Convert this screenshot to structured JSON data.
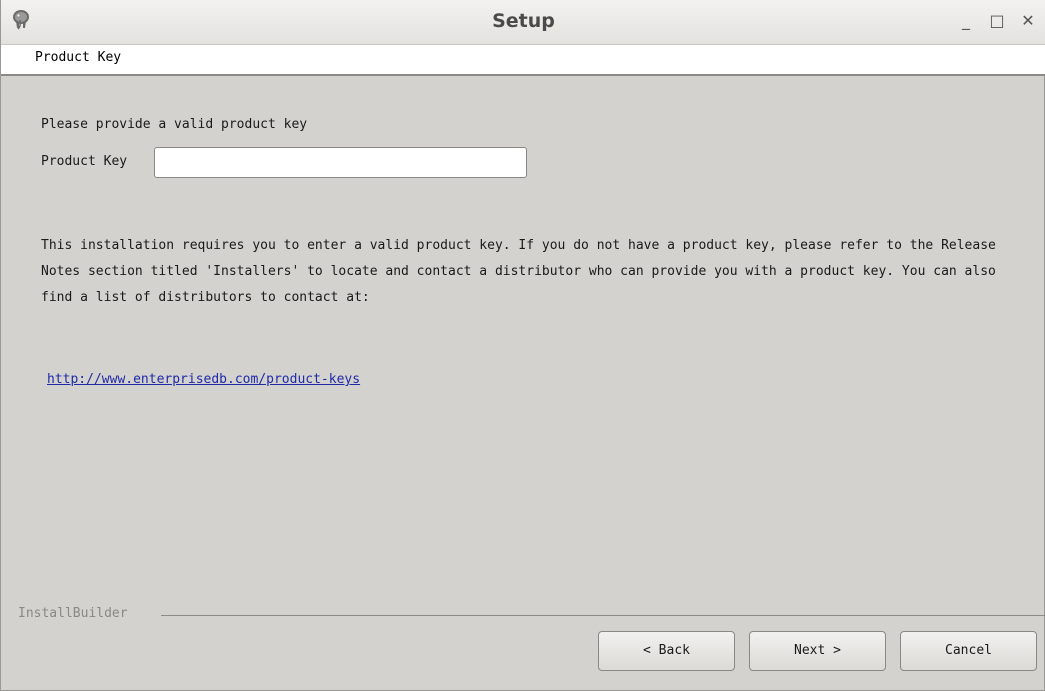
{
  "window": {
    "title": "Setup",
    "app_icon": "postgres-elephant-icon",
    "controls": {
      "minimize": "_",
      "maximize": "□",
      "close": "✕"
    }
  },
  "header": {
    "section_title": "Product Key"
  },
  "main": {
    "prompt": "Please provide a valid product key",
    "field_label": "Product Key",
    "field_value": "",
    "info_text": "This installation requires you to enter a valid product key. If you do not have a product key, please refer to the Release Notes section titled 'Installers' to locate and contact a distributor who can provide you with a product key. You can also find a list of distributors to contact at:",
    "link_text": "http://www.enterprisedb.com/product-keys"
  },
  "footer": {
    "brand": "InstallBuilder",
    "back_label": "< Back",
    "next_label": "Next >",
    "cancel_label": "Cancel"
  },
  "colors": {
    "background": "#d4d2ce",
    "link": "#1e2aa8"
  }
}
